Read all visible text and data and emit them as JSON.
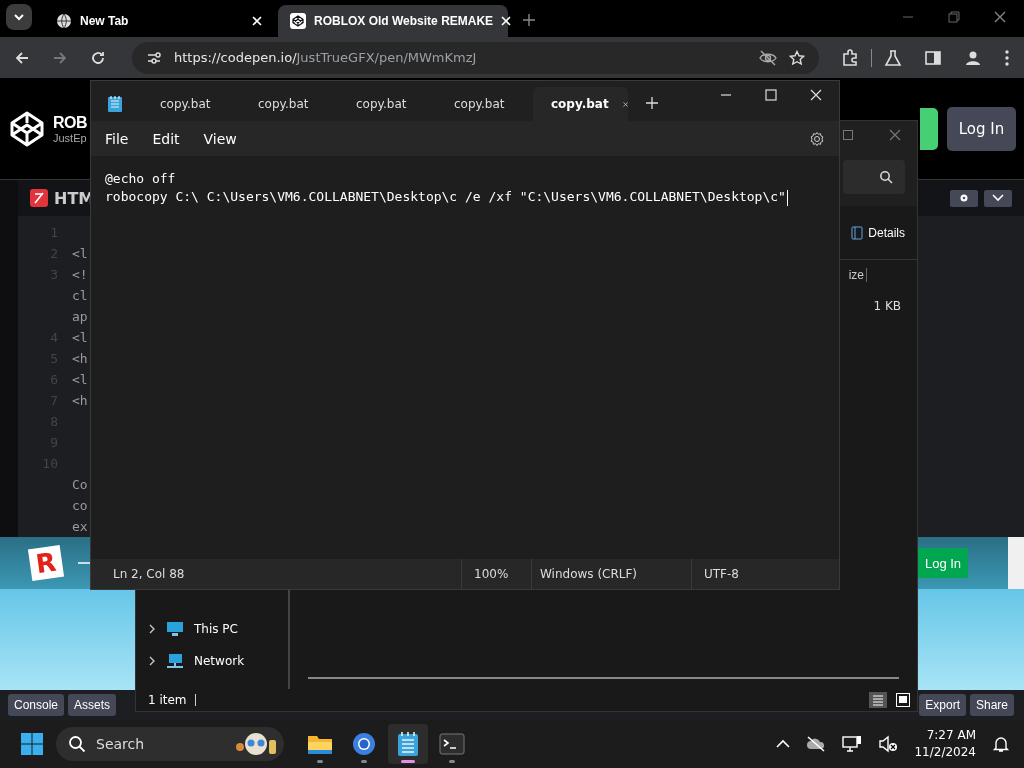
{
  "browser": {
    "tabs": [
      {
        "title": "New Tab",
        "kind": "globe",
        "selected": false
      },
      {
        "title": "ROBLOX Old Website REMAKE",
        "kind": "codepen",
        "selected": true
      }
    ],
    "url": {
      "host": "https://codepen.io/",
      "path": "JustTrueGFX/pen/MWmKmzJ"
    }
  },
  "codepen": {
    "title": "ROB",
    "author": "JustEp",
    "login": "Log In",
    "editor": {
      "title": "HTM",
      "lines": [
        {
          "number": "1"
        },
        {
          "number": "2",
          "code": "<l"
        },
        {
          "number": "3",
          "code": "<!"
        },
        {
          "code": "cl"
        },
        {
          "code": "ap"
        },
        {
          "number": "4",
          "code": "<l"
        },
        {
          "number": "5",
          "code": "<h"
        },
        {
          "number": "6",
          "code": "<l"
        },
        {
          "number": "7",
          "code": "<h"
        },
        {
          "number": "8"
        },
        {
          "number": "9"
        },
        {
          "number": "10"
        },
        {
          "code": "Co"
        },
        {
          "code": "co"
        },
        {
          "code": "ex"
        }
      ]
    },
    "preview": {
      "logo": "R",
      "login": "Log In"
    },
    "footer_left": [
      "Console",
      "Assets"
    ],
    "footer_right": [
      "Export",
      "Share"
    ]
  },
  "explorer": {
    "view_button": "Details",
    "column": "ize",
    "rows": [
      {
        "size": "1 KB"
      }
    ],
    "nav": [
      {
        "label": "This PC",
        "kind": "pc"
      },
      {
        "label": "Network",
        "kind": "network"
      }
    ],
    "status": "1 item"
  },
  "notepad": {
    "tabs": [
      {
        "title": "copy.bat",
        "selected": false
      },
      {
        "title": "copy.bat",
        "selected": false
      },
      {
        "title": "copy.bat",
        "selected": false
      },
      {
        "title": "copy.bat",
        "selected": false
      },
      {
        "title": "copy.bat",
        "selected": true
      }
    ],
    "menu": [
      "File",
      "Edit",
      "View"
    ],
    "lines": [
      "@echo off",
      "robocopy C:\\ C:\\Users\\VM6.COLLABNET\\Desktop\\c /e /xf \"C:\\Users\\VM6.COLLABNET\\Desktop\\c\""
    ],
    "status": {
      "position": "Ln 2, Col 88",
      "zoom": "100%",
      "line_ending": "Windows (CRLF)",
      "encoding": "UTF-8"
    }
  },
  "taskbar": {
    "search": "Search",
    "apps": [
      {
        "kind": "explorer",
        "selected": false
      },
      {
        "kind": "browser",
        "selected": false
      },
      {
        "kind": "notepad",
        "selected": true
      },
      {
        "kind": "terminal",
        "selected": false
      }
    ],
    "time": "7:27 AM",
    "date": "11/2/2024"
  }
}
